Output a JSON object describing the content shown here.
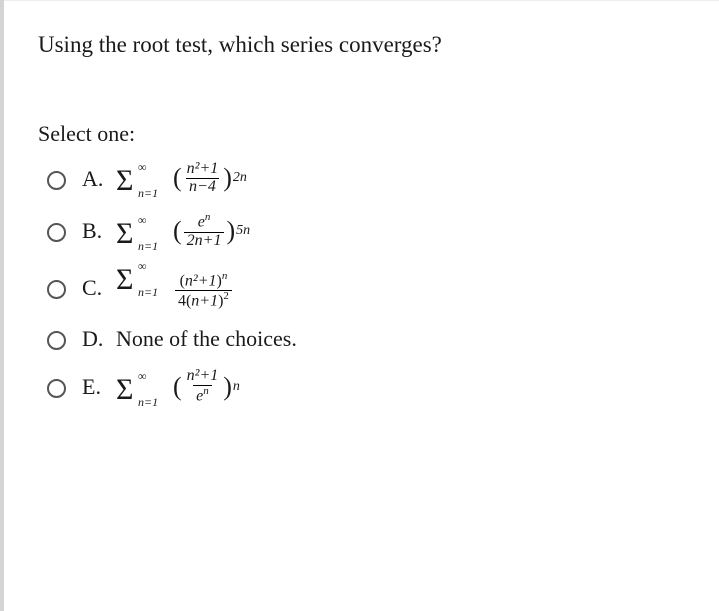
{
  "question": "Using the root test, which series converges?",
  "select_label": "Select one:",
  "options": {
    "A": {
      "letter": "A.",
      "sigma": "Σ",
      "upper": "∞",
      "lower": "n=1",
      "lparen": "(",
      "num": "n²+1",
      "den": "n−4",
      "rparen": ")",
      "exp": "2n"
    },
    "B": {
      "letter": "B.",
      "sigma": "Σ",
      "upper": "∞",
      "lower": "n=1",
      "lparen": "(",
      "num_base": "e",
      "num_exp": "n",
      "den": "2n+1",
      "rparen": ")",
      "exp": "5n"
    },
    "C": {
      "letter": "C.",
      "sigma": "Σ",
      "upper": "∞",
      "lower": "n=1",
      "num_l": "(",
      "num_body": "n²+1",
      "num_r": ")",
      "num_exp": "n",
      "den_coef": "4(",
      "den_body": "n+1",
      "den_r": ")",
      "den_exp": "2"
    },
    "D": {
      "letter": "D.",
      "text": "None of the choices."
    },
    "E": {
      "letter": "E.",
      "sigma": "Σ",
      "upper": "∞",
      "lower": "n=1",
      "lparen": "(",
      "num": "n²+1",
      "den_base": "e",
      "den_exp": "n",
      "rparen": ")",
      "exp": "n"
    }
  }
}
